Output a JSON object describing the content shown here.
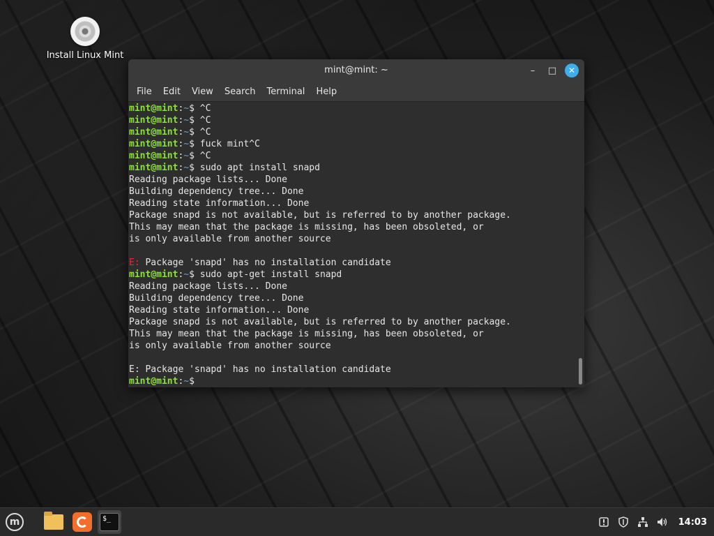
{
  "desktop": {
    "icon_label": "Install Linux Mint"
  },
  "window": {
    "title": "mint@mint: ~",
    "controls": {
      "minimize": "–",
      "maximize": "□",
      "close": "✕"
    }
  },
  "menubar": [
    "File",
    "Edit",
    "View",
    "Search",
    "Terminal",
    "Help"
  ],
  "terminal": {
    "lines": [
      {
        "type": "prompt",
        "user": "mint@mint",
        "path": "~",
        "cmd": "^C"
      },
      {
        "type": "prompt",
        "user": "mint@mint",
        "path": "~",
        "cmd": "^C"
      },
      {
        "type": "prompt",
        "user": "mint@mint",
        "path": "~",
        "cmd": "^C"
      },
      {
        "type": "prompt",
        "user": "mint@mint",
        "path": "~",
        "cmd": "fuck mint^C"
      },
      {
        "type": "prompt",
        "user": "mint@mint",
        "path": "~",
        "cmd": "^C"
      },
      {
        "type": "prompt",
        "user": "mint@mint",
        "path": "~",
        "cmd": "sudo apt install snapd"
      },
      {
        "type": "text",
        "text": "Reading package lists... Done"
      },
      {
        "type": "text",
        "text": "Building dependency tree... Done"
      },
      {
        "type": "text",
        "text": "Reading state information... Done"
      },
      {
        "type": "text",
        "text": "Package snapd is not available, but is referred to by another package."
      },
      {
        "type": "text",
        "text": "This may mean that the package is missing, has been obsoleted, or"
      },
      {
        "type": "text",
        "text": "is only available from another source"
      },
      {
        "type": "text",
        "text": ""
      },
      {
        "type": "error",
        "prefix": "E:",
        "text": " Package 'snapd' has no installation candidate"
      },
      {
        "type": "prompt",
        "user": "mint@mint",
        "path": "~",
        "cmd": "sudo apt-get install snapd"
      },
      {
        "type": "text",
        "text": "Reading package lists... Done"
      },
      {
        "type": "text",
        "text": "Building dependency tree... Done"
      },
      {
        "type": "text",
        "text": "Reading state information... Done"
      },
      {
        "type": "text",
        "text": "Package snapd is not available, but is referred to by another package."
      },
      {
        "type": "text",
        "text": "This may mean that the package is missing, has been obsoleted, or"
      },
      {
        "type": "text",
        "text": "is only available from another source"
      },
      {
        "type": "text",
        "text": ""
      },
      {
        "type": "text",
        "text": "E: Package 'snapd' has no installation candidate"
      },
      {
        "type": "prompt",
        "user": "mint@mint",
        "path": "~",
        "cmd": ""
      }
    ]
  },
  "taskbar": {
    "menu_icon": "mint-logo-icon",
    "apps": [
      "folder-icon",
      "firefox-icon",
      "terminal-icon"
    ],
    "terminal_icon_text": "$_",
    "tray": [
      "update-icon",
      "shield-icon",
      "network-icon",
      "volume-icon"
    ],
    "clock": "14:03"
  },
  "colors": {
    "prompt_user": "#8ae234",
    "prompt_path": "#729fcf",
    "error": "#ef2929",
    "close_button": "#3daee9"
  }
}
